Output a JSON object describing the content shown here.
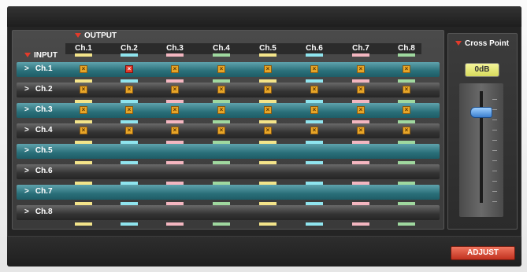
{
  "matrix": {
    "output_label": "OUTPUT",
    "input_label": "INPUT",
    "outputs": [
      {
        "label": "Ch.1",
        "color": "#f3e48a"
      },
      {
        "label": "Ch.2",
        "color": "#8fe4ee"
      },
      {
        "label": "Ch.3",
        "color": "#f3b6c0"
      },
      {
        "label": "Ch.4",
        "color": "#9fd89f"
      },
      {
        "label": "Ch.5",
        "color": "#f3e48a"
      },
      {
        "label": "Ch.6",
        "color": "#8fe4ee"
      },
      {
        "label": "Ch.7",
        "color": "#f3b6c0"
      },
      {
        "label": "Ch.8",
        "color": "#9fd89f"
      }
    ],
    "inputs": [
      {
        "label": "Ch.1",
        "style": "teal"
      },
      {
        "label": "Ch.2",
        "style": "dark"
      },
      {
        "label": "Ch.3",
        "style": "teal"
      },
      {
        "label": "Ch.4",
        "style": "dark"
      },
      {
        "label": "Ch.5",
        "style": "teal"
      },
      {
        "label": "Ch.6",
        "style": "dark"
      },
      {
        "label": "Ch.7",
        "style": "teal"
      },
      {
        "label": "Ch.8",
        "style": "dark"
      }
    ],
    "crosspoints": [
      [
        "x",
        "r",
        "x",
        "x",
        "x",
        "x",
        "x",
        "x"
      ],
      [
        "x",
        "x",
        "x",
        "x",
        "x",
        "x",
        "x",
        "x"
      ],
      [
        "x",
        "x",
        "x",
        "x",
        "x",
        "x",
        "x",
        "x"
      ],
      [
        "x",
        "x",
        "x",
        "x",
        "x",
        "x",
        "x",
        "x"
      ],
      [
        "",
        "",
        "",
        "",
        "",
        "",
        "",
        ""
      ],
      [
        "",
        "",
        "",
        "",
        "",
        "",
        "",
        ""
      ],
      [
        "",
        "",
        "",
        "",
        "",
        "",
        "",
        ""
      ],
      [
        "",
        "",
        "",
        "",
        "",
        "",
        "",
        ""
      ]
    ],
    "row_arrow": ">"
  },
  "cross_point": {
    "title": "Cross Point",
    "gain_value": "0dB",
    "fader_level": 0.85
  },
  "adjust_label": "ADJUST",
  "accent_color": "#e33b2b"
}
